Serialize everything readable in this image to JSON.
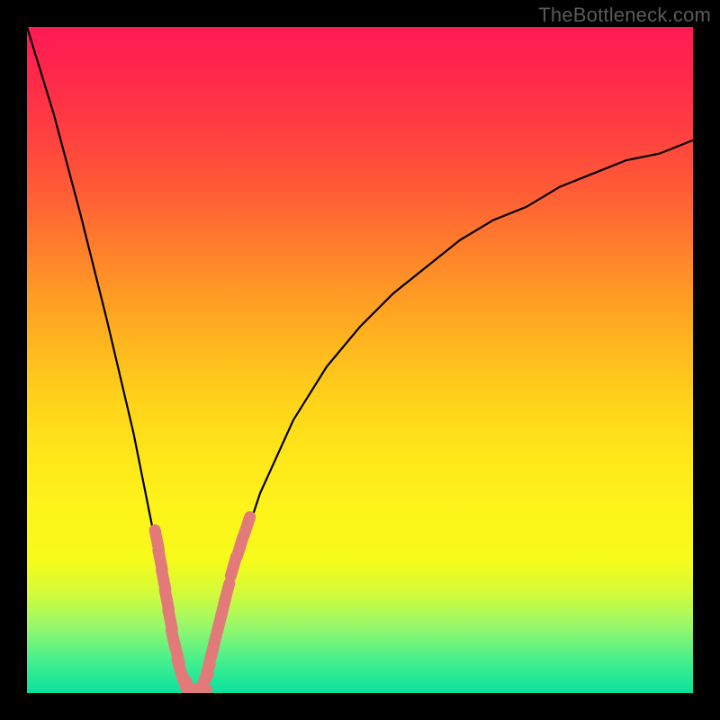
{
  "watermark": "TheBottleneck.com",
  "chart_data": {
    "type": "line",
    "title": "",
    "xlabel": "",
    "ylabel": "",
    "xlim": [
      0,
      100
    ],
    "ylim": [
      0,
      100
    ],
    "grid": false,
    "legend": false,
    "curve": {
      "description": "V-shaped bottleneck curve — y is mismatch percentage vs component balance x; minimum (0% bottleneck) near x≈25",
      "x": [
        0,
        4,
        8,
        12,
        16,
        18,
        20,
        21,
        22,
        23,
        24,
        25,
        26,
        27,
        28,
        29,
        30,
        32,
        35,
        40,
        45,
        50,
        55,
        60,
        65,
        70,
        75,
        80,
        85,
        90,
        95,
        100
      ],
      "y": [
        100,
        87,
        72,
        56,
        39,
        29,
        19,
        14,
        9,
        5,
        2,
        0,
        0,
        2,
        6,
        10,
        14,
        21,
        30,
        41,
        49,
        55,
        60,
        64,
        68,
        71,
        73,
        76,
        78,
        80,
        81,
        83
      ]
    },
    "markers": {
      "description": "Recommended hardware data points clustered along both arms near the valley",
      "color": "#e27a7a",
      "points": [
        {
          "x": 19.5,
          "y": 23
        },
        {
          "x": 20.0,
          "y": 20
        },
        {
          "x": 20.5,
          "y": 17
        },
        {
          "x": 21.0,
          "y": 14
        },
        {
          "x": 21.5,
          "y": 11
        },
        {
          "x": 22.0,
          "y": 8
        },
        {
          "x": 22.5,
          "y": 6
        },
        {
          "x": 23.0,
          "y": 3.5
        },
        {
          "x": 23.5,
          "y": 2
        },
        {
          "x": 24.0,
          "y": 1
        },
        {
          "x": 24.5,
          "y": 0.5
        },
        {
          "x": 25.5,
          "y": 0.5
        },
        {
          "x": 26.5,
          "y": 1.5
        },
        {
          "x": 27.0,
          "y": 3
        },
        {
          "x": 27.5,
          "y": 5
        },
        {
          "x": 28.0,
          "y": 7
        },
        {
          "x": 28.5,
          "y": 9
        },
        {
          "x": 29.0,
          "y": 11
        },
        {
          "x": 29.5,
          "y": 13
        },
        {
          "x": 30.0,
          "y": 15
        },
        {
          "x": 31.0,
          "y": 19
        },
        {
          "x": 32.0,
          "y": 22
        },
        {
          "x": 33.0,
          "y": 25
        }
      ]
    },
    "gradient_stops": [
      {
        "pct": 0,
        "color": "#ff1a55"
      },
      {
        "pct": 50,
        "color": "#ffd21a"
      },
      {
        "pct": 80,
        "color": "#f6fb1a"
      },
      {
        "pct": 100,
        "color": "#08e29d"
      }
    ]
  }
}
